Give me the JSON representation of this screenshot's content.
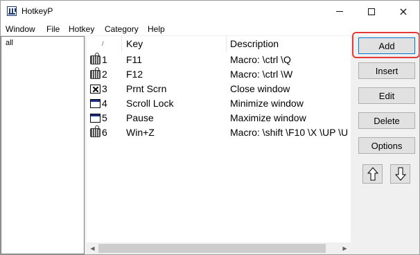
{
  "window": {
    "title": "HotkeyP",
    "controls": {
      "minimize": "minimize",
      "maximize": "maximize",
      "close": "×"
    }
  },
  "menubar": {
    "items": [
      "Window",
      "File",
      "Hotkey",
      "Category",
      "Help"
    ]
  },
  "categories": {
    "items": [
      "all"
    ]
  },
  "list": {
    "columns": {
      "sort_indicator": "/",
      "key": "Key",
      "description": "Description"
    },
    "rows": [
      {
        "icon": "keyboard-icon",
        "index": "1",
        "key": "F11",
        "description": "Macro: \\ctrl \\Q"
      },
      {
        "icon": "keyboard-icon",
        "index": "2",
        "key": "F12",
        "description": "Macro: \\ctrl \\W"
      },
      {
        "icon": "close-window-icon",
        "index": "3",
        "key": "Prnt Scrn",
        "description": "Close window"
      },
      {
        "icon": "window-icon",
        "index": "4",
        "key": "Scroll Lock",
        "description": "Minimize window"
      },
      {
        "icon": "window-icon",
        "index": "5",
        "key": "Pause",
        "description": "Maximize window"
      },
      {
        "icon": "keyboard-icon",
        "index": "6",
        "key": "Win+Z",
        "description": "Macro: \\shift \\F10 \\X \\UP \\U"
      }
    ]
  },
  "buttons": {
    "add": "Add",
    "insert": "Insert",
    "edit": "Edit",
    "delete": "Delete",
    "options": "Options"
  },
  "colors": {
    "highlight": "#e53935",
    "focus_border": "#0078d7",
    "titlebar_accent": "#1c2c8a"
  }
}
